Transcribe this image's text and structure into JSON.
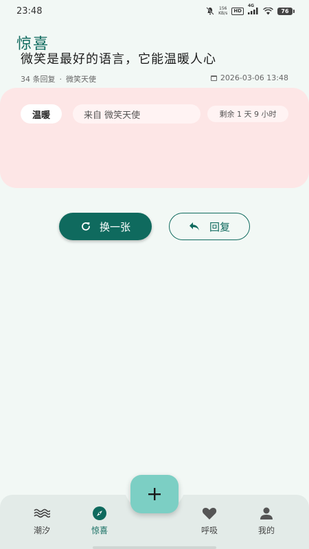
{
  "status_bar": {
    "time": "23:48",
    "net_speed_value": "156",
    "net_speed_unit": "KB/s",
    "hd": "HD",
    "network": "4G",
    "battery": "76",
    "icons": [
      "mute-bell-icon",
      "signal-icon",
      "wifi-icon",
      "battery-icon"
    ]
  },
  "header": {
    "title": "惊喜"
  },
  "card": {
    "tag": "温暖",
    "from": "来自 微笑天使",
    "remaining": "剩余 1 天 9 小时",
    "text": "微笑是最好的语言，它能温暖人心",
    "reply_count": "34 条回复",
    "separator": "·",
    "author": "微笑天使",
    "date": "2026-03-06 13:48",
    "background_color": "#fde6e6"
  },
  "actions": {
    "swap_label": "换一张",
    "reply_label": "回复"
  },
  "bottom_nav": {
    "items": [
      {
        "label": "潮汐",
        "icon": "waves-icon"
      },
      {
        "label": "惊喜",
        "icon": "compass-icon",
        "active": true
      },
      {
        "label": "呼吸",
        "icon": "heart-icon"
      },
      {
        "label": "我的",
        "icon": "person-icon"
      }
    ],
    "fab_icon": "plus-icon"
  },
  "colors": {
    "accent": "#0f6a5e",
    "background": "#f2f8f5",
    "fab": "#7ccfc4"
  }
}
